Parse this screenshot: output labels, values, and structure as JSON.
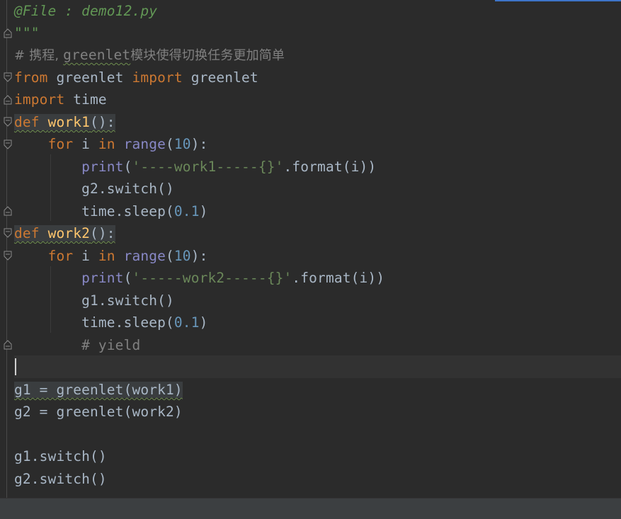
{
  "editor": {
    "file_name": "demo12.py",
    "lines": {
      "l1": "@File : demo12.py",
      "l2": "\"\"\"",
      "l3_prefix": "# 携程, ",
      "l3_word": "greenlet",
      "l3_rest": "模块使得切换任务更加简单",
      "l4_kw1": "from",
      "l4_mod": " greenlet ",
      "l4_kw2": "import",
      "l4_name": " greenlet",
      "l5_kw": "import",
      "l5_name": " time",
      "l6_kw": "def",
      "l6_fn": "work1",
      "l6_rest": "():",
      "l7_for": "for",
      "l7_i": " i ",
      "l7_in": "in",
      "l7_range": "range",
      "l7_open": "(",
      "l7_num": "10",
      "l7_close": "):",
      "l8_print": "print",
      "l8_open": "(",
      "l8_str": "'----work1-----{}'",
      "l8_rest": ".format(i))",
      "l9": "g2.switch()",
      "l10_a": "time.sleep(",
      "l10_num": "0.1",
      "l10_b": ")",
      "l11_kw": "def",
      "l11_fn": "work2",
      "l11_rest": "():",
      "l12_for": "for",
      "l12_i": " i ",
      "l12_in": "in",
      "l12_range": "range",
      "l12_open": "(",
      "l12_num": "10",
      "l12_close": "):",
      "l13_print": "print",
      "l13_open": "(",
      "l13_str": "'-----work2-----{}'",
      "l13_rest": ".format(i))",
      "l14": "g1.switch()",
      "l15_a": "time.sleep(",
      "l15_num": "0.1",
      "l15_b": ")",
      "l16": "# yield",
      "l18": "g1 = greenlet(work1)",
      "l19": "g2 = greenlet(work2)",
      "l21": "g1.switch()",
      "l22": "g2.switch()"
    }
  },
  "colors": {
    "background": "#2b2b2b",
    "keyword": "#cc7832",
    "function": "#ffc66d",
    "builtin": "#8888c6",
    "number": "#6897bb",
    "string": "#6a8759",
    "comment": "#808080",
    "docstring": "#629755"
  }
}
